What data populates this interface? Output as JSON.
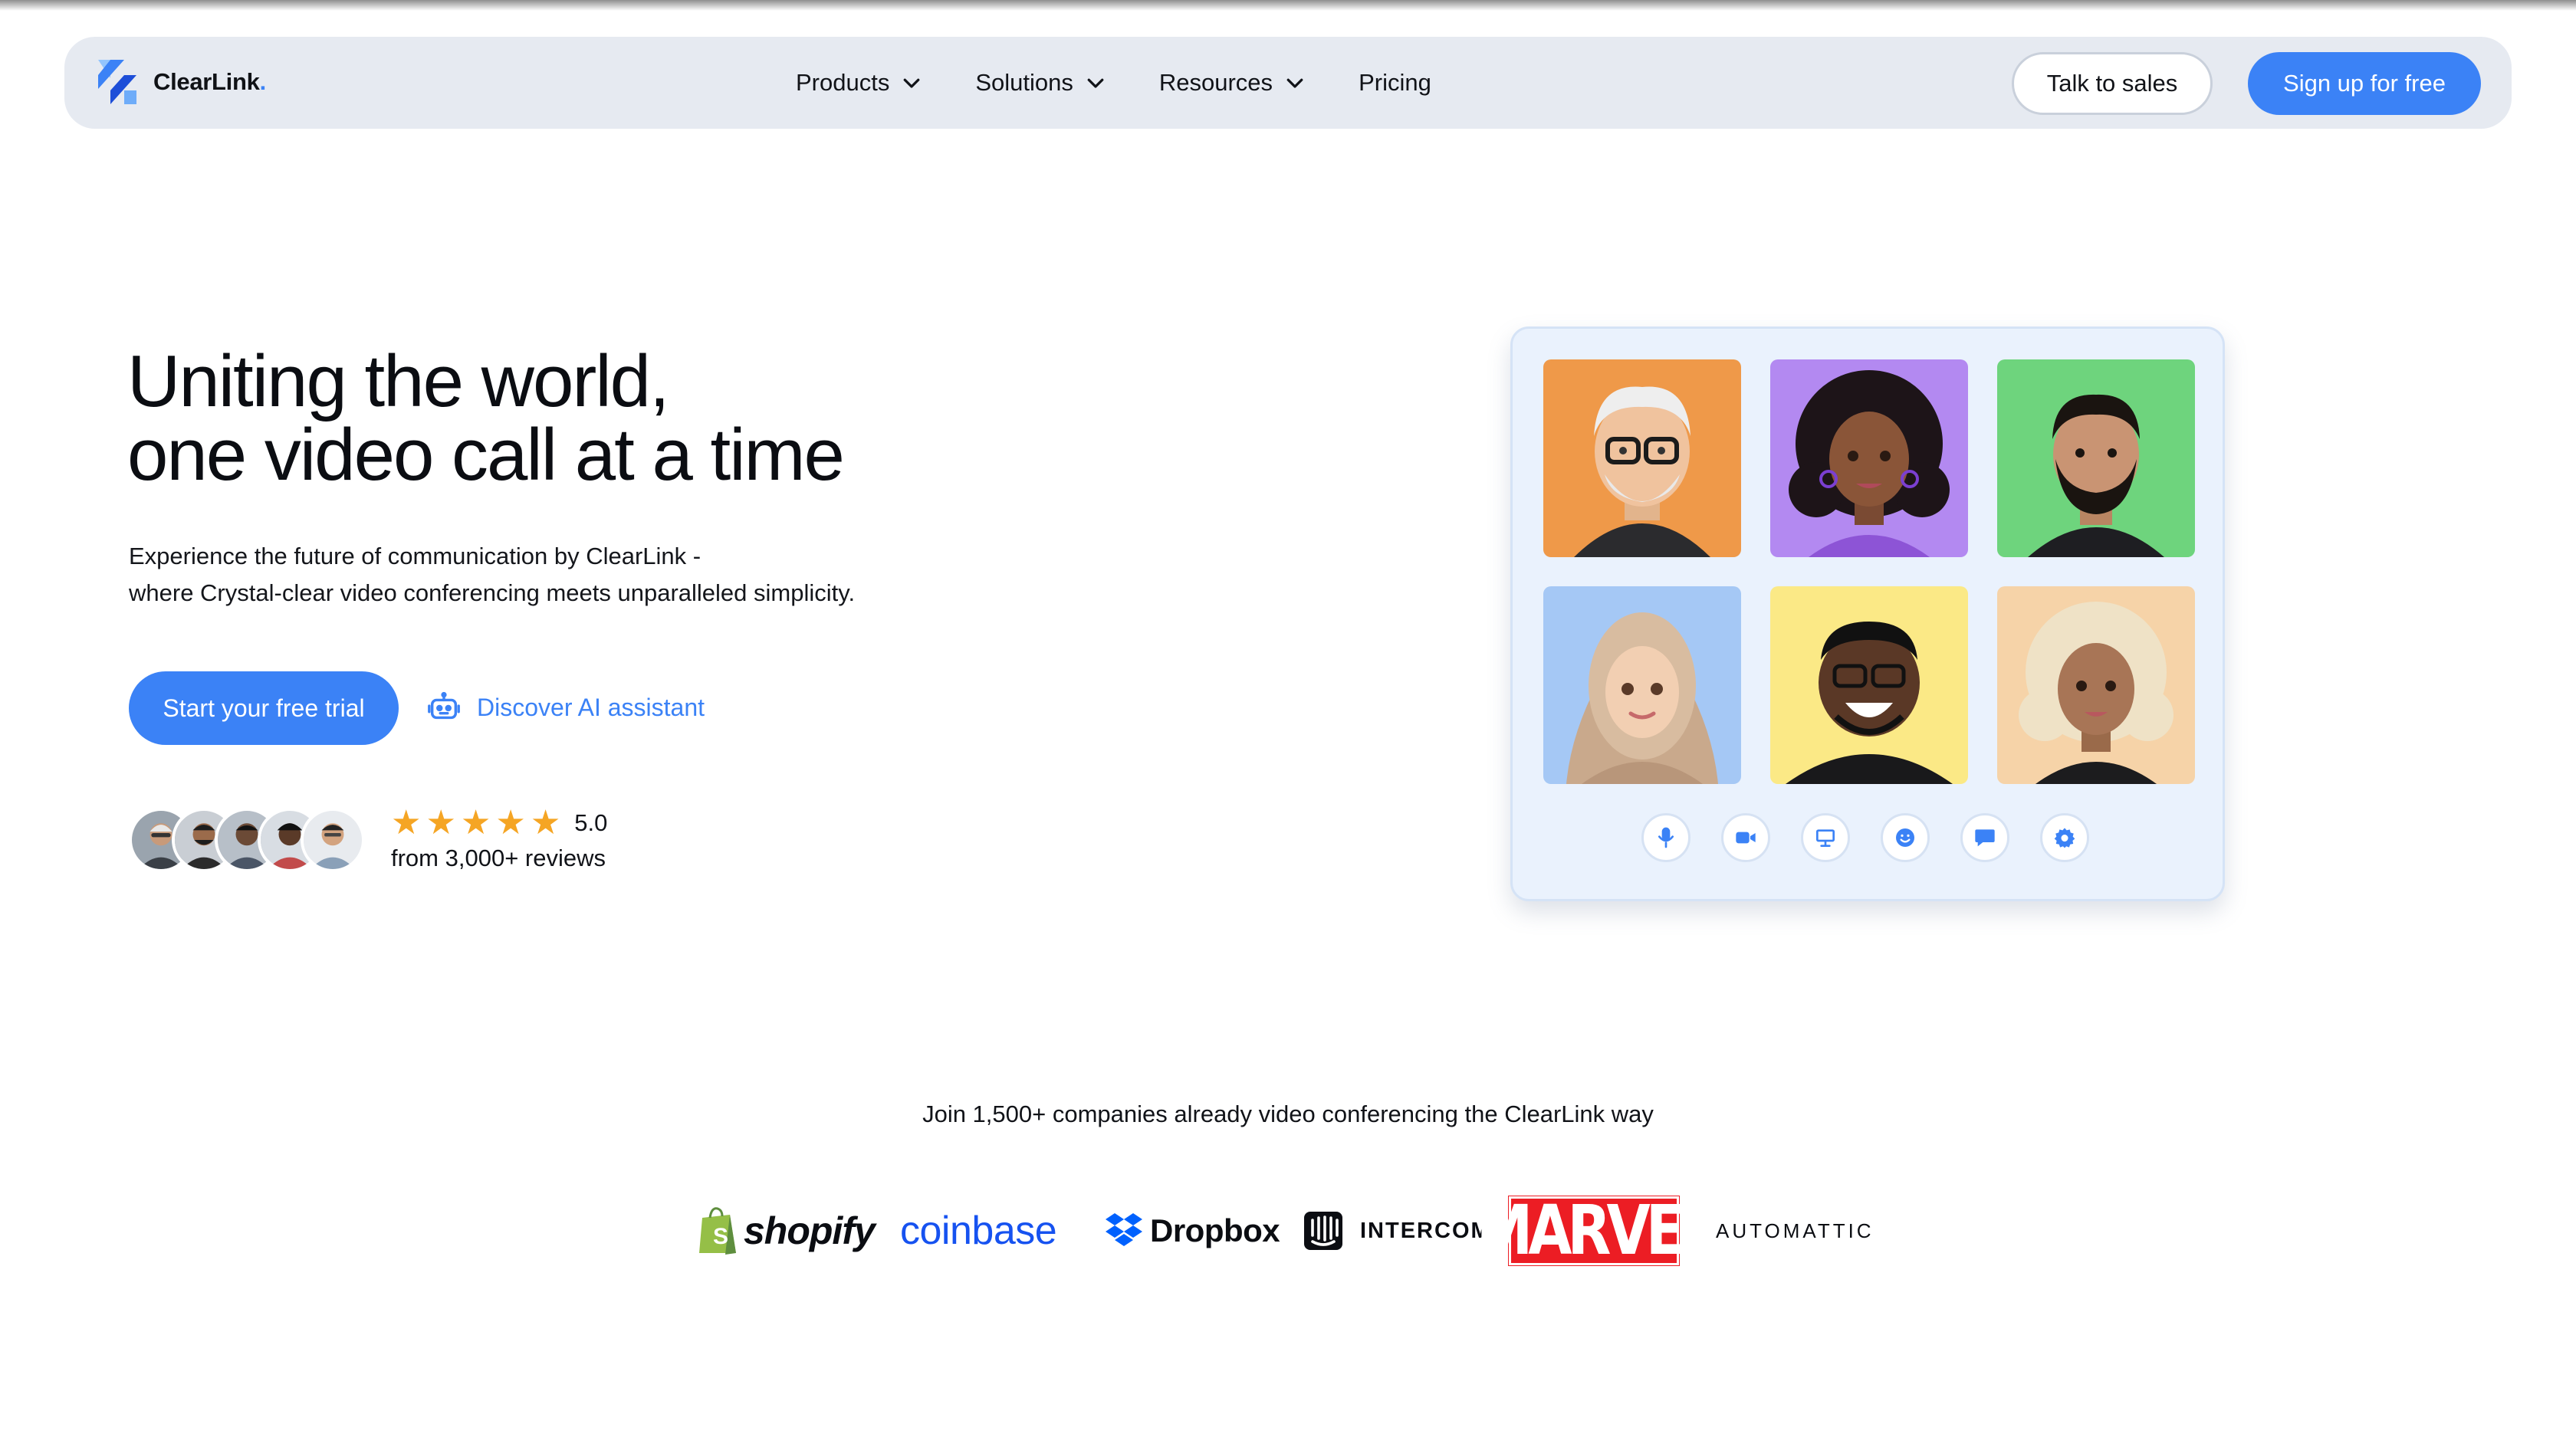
{
  "brand": {
    "name": "ClearLink",
    "dot": ".",
    "accent": "#3b82f6"
  },
  "nav": {
    "items": [
      {
        "label": "Products",
        "has_dropdown": true
      },
      {
        "label": "Solutions",
        "has_dropdown": true
      },
      {
        "label": "Resources",
        "has_dropdown": true
      },
      {
        "label": "Pricing",
        "has_dropdown": false
      }
    ],
    "talk_to_sales": "Talk to sales",
    "sign_up": "Sign up for free"
  },
  "hero": {
    "title_line1": "Uniting the world,",
    "title_line2": "one video call at a time",
    "subtitle_line1": "Experience the future of communication by ClearLink -",
    "subtitle_line2": "where Crystal-clear video conferencing meets unparalleled simplicity.",
    "cta_primary": "Start your free trial",
    "cta_secondary": "Discover AI assistant",
    "cta_secondary_icon": "robot-icon"
  },
  "rating": {
    "stars": 5,
    "score": "5.0",
    "reviews": "from 3,000+ reviews"
  },
  "video_call": {
    "tile_colors": [
      "#ef9949",
      "#b389f1",
      "#6ed47d",
      "#a5c8f5",
      "#fbe986",
      "#f6d3a8"
    ],
    "controls": [
      "microphone-icon",
      "camera-icon",
      "screen-share-icon",
      "emoji-icon",
      "chat-icon",
      "settings-icon"
    ]
  },
  "trust": {
    "text": "Join 1,500+ companies already video conferencing the ClearLink way",
    "logos": [
      {
        "name": "shopify",
        "text": "shopify"
      },
      {
        "name": "coinbase",
        "text": "coinbase"
      },
      {
        "name": "dropbox",
        "text": "Dropbox"
      },
      {
        "name": "intercom",
        "text": "INTERCOM"
      },
      {
        "name": "marvel",
        "text": "MARVEL"
      },
      {
        "name": "automattic",
        "text": "AUTOMATTIC"
      }
    ]
  }
}
